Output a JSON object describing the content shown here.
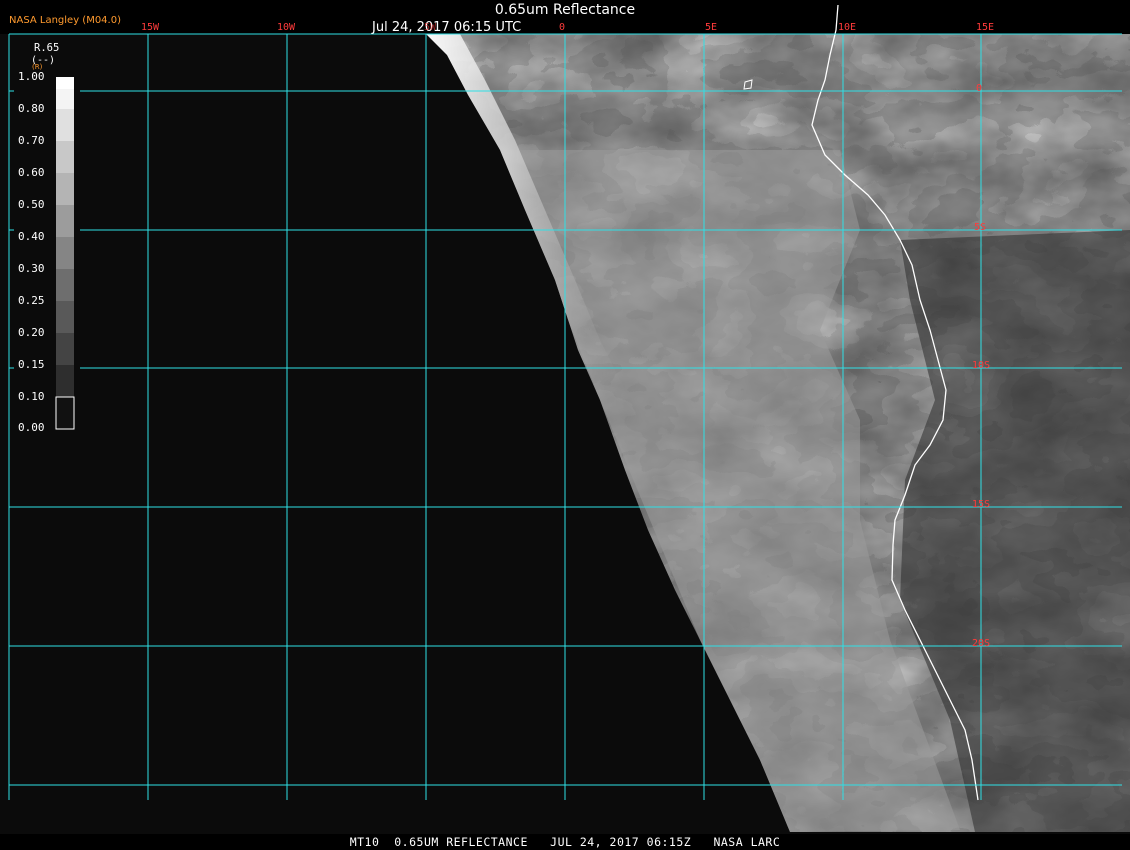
{
  "header": {
    "credit": "NASA Langley (M04.0)",
    "title": "0.65um Reflectance",
    "timestamp": "Jul 24, 2017 06:15 UTC"
  },
  "footer": {
    "caption": "MT10  0.65UM REFLECTANCE   JUL 24, 2017 06:15Z   NASA LARC"
  },
  "map": {
    "longitude_labels": [
      "15W",
      "10W",
      "5W",
      "0",
      "5E",
      "10E",
      "15E"
    ],
    "latitude_labels": [
      "0",
      "5S",
      "10S",
      "15S",
      "20S"
    ],
    "grid_color": "#2fe0e6",
    "label_color": "#ff3b3b",
    "coastline_color": "#ffffff",
    "space_color": "#0b0b0b"
  },
  "colorbar": {
    "variable": "R.65",
    "unit": "(--)",
    "sub_label": "(R)",
    "ticks": [
      "1.00",
      "0.80",
      "0.70",
      "0.60",
      "0.50",
      "0.40",
      "0.30",
      "0.25",
      "0.20",
      "0.15",
      "0.10",
      "0.00"
    ]
  }
}
